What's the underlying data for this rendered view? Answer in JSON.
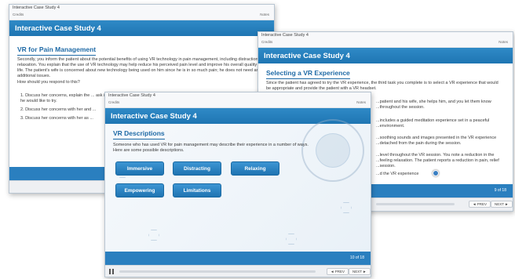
{
  "course": {
    "crumb": "Interactive Case Study 4",
    "credits": "Credits",
    "notes": "Notes"
  },
  "win1": {
    "header": "Interactive Case Study 4",
    "heading": "VR for Pain Management",
    "body": "Secondly, you inform the patient about the potential benefits of using VR technology in pain management, including distraction and relaxation. You explain that the use of VR technology may help reduce his perceived pain level and improve his overall quality of life. The patient's wife is concerned about new technology being used on him since he is in so much pain; he does not need any additional issues.",
    "question": "How should you respond to this?",
    "options": [
      "1.  Discuss her concerns, explain the ... ask if he would like to try.",
      "2.  Discuss her concerns with her and ...",
      "3.  Discuss her concerns with her as ..."
    ]
  },
  "win2": {
    "header": "Interactive Case Study 4",
    "heading": "Selecting a VR Experience",
    "paragraphs": [
      "Since the patient has agreed to try the VR experience, the third task you complete is to select a VR experience that would be appropriate and provide the patient with a VR headset.",
      "...patient and his wife, she helps him, and you let them know ...throughout the session.",
      "...includes a guided meditation experience set in a peaceful ...environment.",
      "...soothing sounds and images presented in the VR experience ...detached from the pain during the session.",
      "...level throughout the VR session. You note a reduction in the ...feeling relaxation. The patient reports a reduction in pain, relief ...session.",
      "...d the VR experience"
    ],
    "pager": "9 of 18",
    "prev": "◄ PREV",
    "next": "NEXT ►"
  },
  "win3": {
    "header": "Interactive Case Study 4",
    "heading": "VR Descriptions",
    "intro": "Someone who has used VR for pain management may describe their experience in a number of ways. Here are some possible descriptions.",
    "buttons": [
      "Immersive",
      "Distracting",
      "Relaxing",
      "Empowering",
      "Limitations"
    ],
    "pager": "10 of 18",
    "prev": "◄ PREV",
    "next": "NEXT ►"
  }
}
